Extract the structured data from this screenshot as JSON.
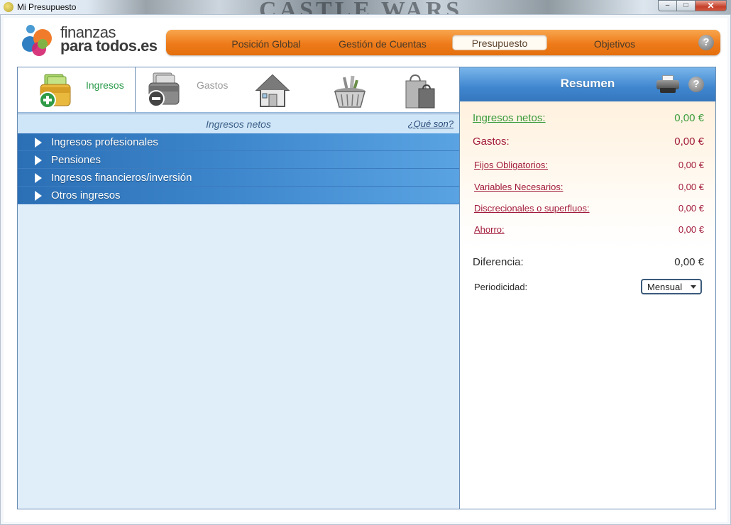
{
  "window": {
    "title": "Mi Presupuesto",
    "background_text": "CASTLE WARS",
    "controls": {
      "minimize": "–",
      "maximize": "□",
      "close": "✕"
    }
  },
  "logo": {
    "line1": "finanzas",
    "line2": "para todos.es"
  },
  "nav": {
    "items": [
      {
        "label": "Posición Global",
        "active": false
      },
      {
        "label": "Gestión de Cuentas",
        "active": false
      },
      {
        "label": "Presupuesto",
        "active": true
      },
      {
        "label": "Objetivos",
        "active": false
      }
    ],
    "help": "?"
  },
  "categories": {
    "income_label": "Ingresos",
    "expense_label": "Gastos",
    "icons": [
      "income-wallet-icon",
      "expense-wallet-icon",
      "house-icon",
      "shopping-basket-icon",
      "shopping-bags-icon"
    ]
  },
  "income": {
    "subheader": "Ingresos netos",
    "help_link": "¿Qué son?",
    "rows": [
      {
        "label": "Ingresos profesionales"
      },
      {
        "label": "Pensiones"
      },
      {
        "label": "Ingresos financieros/inversión"
      },
      {
        "label": "Otros ingresos"
      }
    ]
  },
  "summary": {
    "title": "Resumen",
    "help": "?",
    "net_income": {
      "label": "Ingresos netos:",
      "value": "0,00 €"
    },
    "expenses": {
      "label": "Gastos:",
      "value": "0,00 €"
    },
    "fixed": {
      "label": "Fijos Obligatorios:",
      "value": "0,00 €"
    },
    "variable": {
      "label": "Variables Necesarios:",
      "value": "0,00 €"
    },
    "discretionary": {
      "label": "Discrecionales o superfluos:",
      "value": "0,00 €"
    },
    "savings": {
      "label": "Ahorro:",
      "value": "0,00 €"
    },
    "difference": {
      "label": "Diferencia:",
      "value": "0,00 €"
    },
    "periodicity": {
      "label": "Periodicidad:",
      "value": "Mensual"
    }
  },
  "colors": {
    "accent_orange": "#ee7b1a",
    "income_green": "#2a9a4a",
    "expense_red": "#a21b3a",
    "row_blue": "#3c85cb"
  }
}
